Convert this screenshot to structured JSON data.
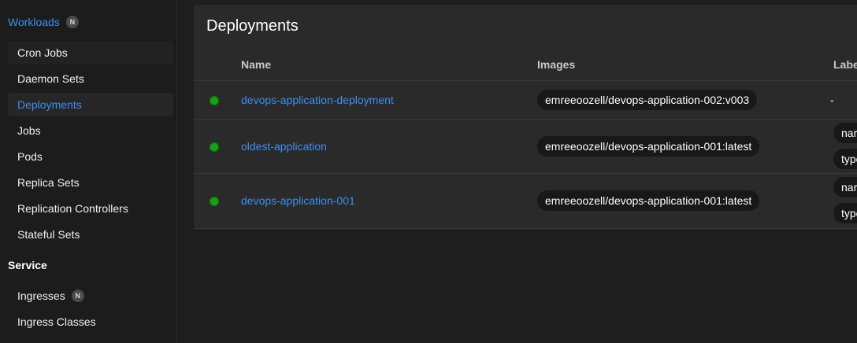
{
  "sidebar": {
    "workloads": {
      "title": "Workloads",
      "badge": "N"
    },
    "items": [
      {
        "label": "Cron Jobs"
      },
      {
        "label": "Daemon Sets"
      },
      {
        "label": "Deployments"
      },
      {
        "label": "Jobs"
      },
      {
        "label": "Pods"
      },
      {
        "label": "Replica Sets"
      },
      {
        "label": "Replication Controllers"
      },
      {
        "label": "Stateful Sets"
      }
    ],
    "service": {
      "title": "Service"
    },
    "service_items": [
      {
        "label": "Ingresses",
        "badge": "N"
      },
      {
        "label": "Ingress Classes"
      }
    ]
  },
  "main": {
    "title": "Deployments",
    "columns": {
      "name": "Name",
      "images": "Images",
      "labels": "Labe"
    },
    "rows": [
      {
        "name": "devops-application-deployment",
        "image": "emreeoozell/devops-application-002:v003",
        "labels": "-",
        "status": "running"
      },
      {
        "name": "oldest-application",
        "image": "emreeoozell/devops-application-001:latest",
        "labels": [
          "nar",
          "type"
        ],
        "status": "running"
      },
      {
        "name": "devops-application-001",
        "image": "emreeoozell/devops-application-001:latest",
        "labels": [
          "nar",
          "type"
        ],
        "status": "running"
      }
    ]
  },
  "colors": {
    "accent": "#3d8ef0",
    "status_ok": "#16a116",
    "background": "#1e1e1e"
  }
}
